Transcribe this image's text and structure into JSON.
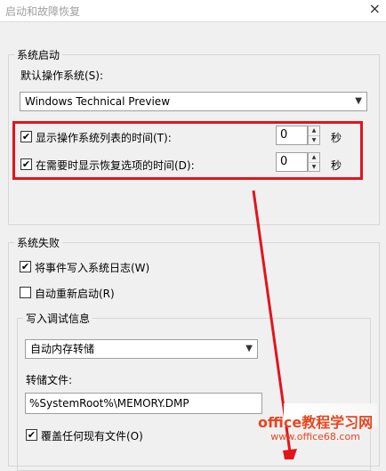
{
  "window": {
    "title": "启动和故障恢复"
  },
  "system_startup": {
    "group_title": "系统启动",
    "default_os_label": "默认操作系统(S):",
    "default_os_value": "Windows Technical Preview",
    "show_os_list": {
      "label": "显示操作系统列表的时间(T):",
      "checked": true,
      "value": "0",
      "unit": "秒"
    },
    "show_recovery": {
      "label": "在需要时显示恢复选项的时间(D):",
      "checked": true,
      "value": "0",
      "unit": "秒"
    }
  },
  "system_failure": {
    "group_title": "系统失败",
    "write_event": {
      "label": "将事件写入系统日志(W)",
      "checked": true
    },
    "auto_restart": {
      "label": "自动重新启动(R)",
      "checked": false
    },
    "debug_info": {
      "group_title": "写入调试信息",
      "dump_type": "自动内存转储",
      "dump_file_label": "转储文件:",
      "dump_file_value": "%SystemRoot%\\MEMORY.DMP",
      "overwrite": {
        "label": "覆盖任何现有文件(O)",
        "checked": true
      }
    }
  },
  "watermark": {
    "line1": "office教程学习网",
    "line2": "www.office68.com"
  },
  "colors": {
    "highlight": "#e2141c",
    "arrow": "#e2141c",
    "watermark": "#e8451f"
  },
  "icons": {
    "checkmark": "✔",
    "chevron_down": "▼",
    "close": "×"
  }
}
